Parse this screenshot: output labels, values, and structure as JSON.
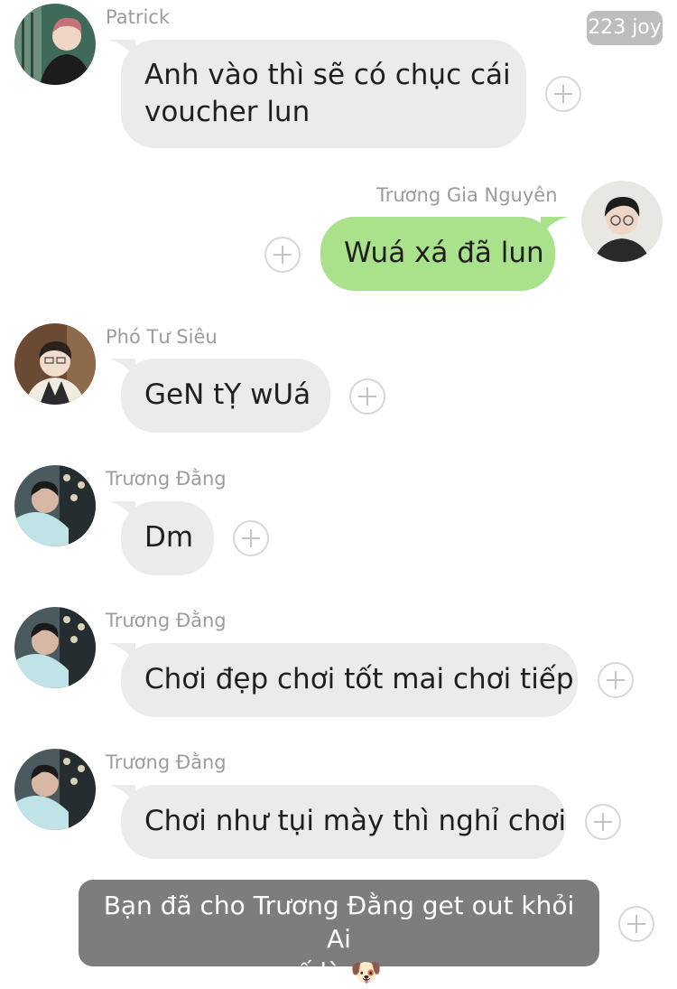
{
  "status": {
    "joy_badge": "223 joy"
  },
  "messages": [
    {
      "sender": "Patrick",
      "line1": "Anh vào thì sẽ có chục cái",
      "line2": "voucher lun",
      "avatar": "avatar-patrick"
    },
    {
      "sender": "Trương Gia Nguyên",
      "text": "Wuá xá đã lun",
      "avatar": "avatar-truong-gia-nguyen"
    },
    {
      "sender": "Phó Tư Siêu",
      "text": "GeN tỴ wUá",
      "avatar": "avatar-pho-tu-sieu"
    },
    {
      "sender": "Trương Đằng",
      "text": "Dm",
      "avatar": "avatar-truong-dang"
    },
    {
      "sender": "Trương Đằng",
      "text": "Chơi đẹp chơi tốt mai chơi tiếp",
      "avatar": "avatar-truong-dang"
    },
    {
      "sender": "Trương Đằng",
      "text": "Chơi như tụi mày thì nghỉ chơi",
      "avatar": "avatar-truong-dang"
    }
  ],
  "system_message": {
    "line1": "Bạn đã cho Trương Đằng get out khỏi Ai",
    "line2": "ế là 🐶"
  },
  "colors": {
    "incoming_bubble": "#ebebeb",
    "outgoing_bubble": "#a9e28a",
    "system_bubble": "#7d7d7d",
    "sender_text": "#9c9c9c"
  },
  "icons": {
    "add_reaction": "plus-circle-icon"
  }
}
